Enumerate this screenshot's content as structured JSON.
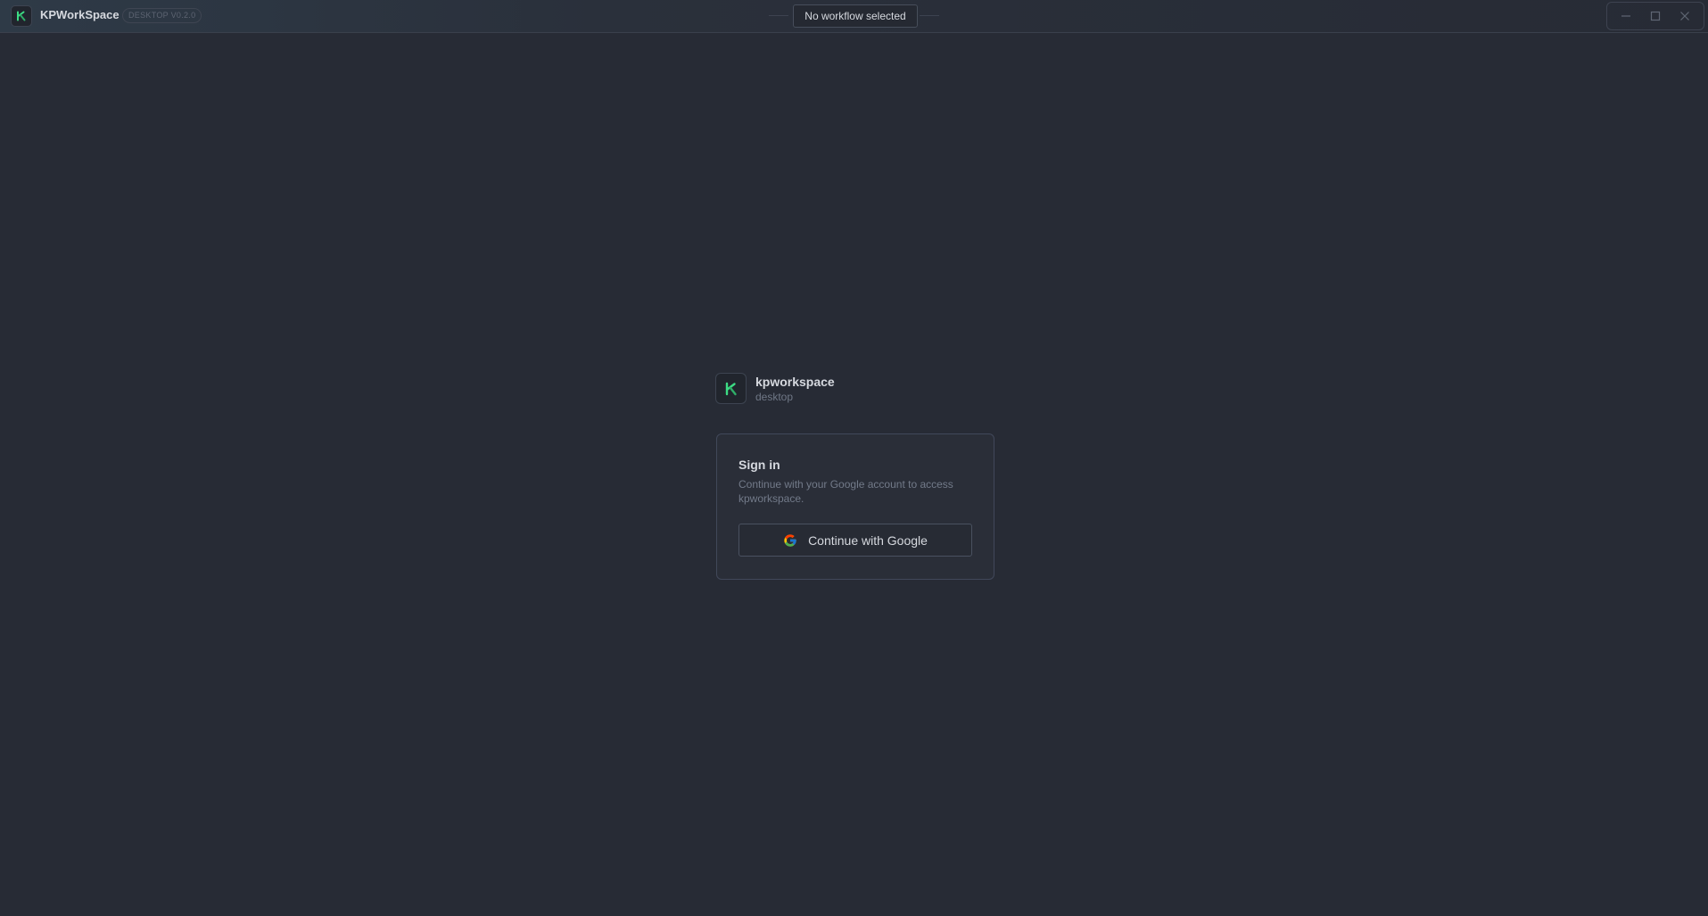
{
  "titlebar": {
    "app_name": "KPWorkSpace",
    "version_badge": "DESKTOP V0.2.0",
    "workflow_status": "No workflow selected",
    "controls": {
      "minimize": "minimize-icon",
      "maximize": "maximize-icon",
      "close": "close-icon"
    }
  },
  "brand": {
    "name": "kpworkspace",
    "subtitle": "desktop",
    "icon": "kp-logo-icon"
  },
  "signin": {
    "title": "Sign in",
    "description": "Continue with your Google account to access kpworkspace.",
    "button_label": "Continue with Google",
    "button_icon": "google-icon"
  },
  "colors": {
    "background": "#272b35",
    "card": "#2a2e38",
    "accent_green": "#3ddc84",
    "text_primary": "#d6d9df",
    "text_muted": "#727a89"
  }
}
